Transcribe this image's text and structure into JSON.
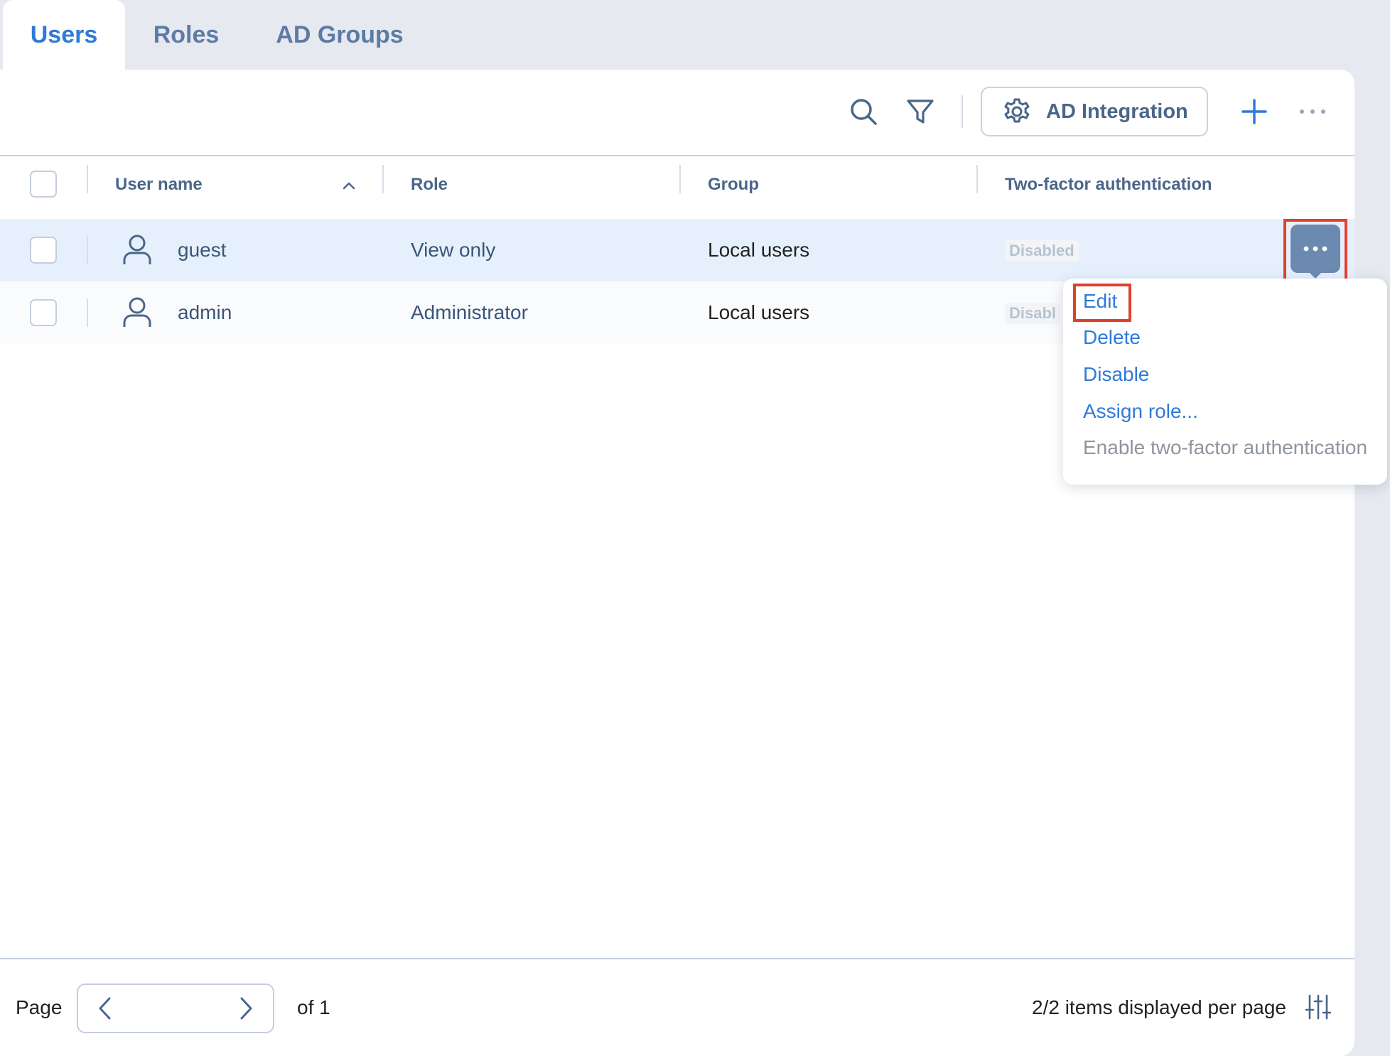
{
  "tabs": [
    {
      "label": "Users",
      "active": true
    },
    {
      "label": "Roles",
      "active": false
    },
    {
      "label": "AD Groups",
      "active": false
    }
  ],
  "toolbar": {
    "search_icon": "search-icon",
    "filter_icon": "filter-icon",
    "ad_integration_label": "AD Integration",
    "add_icon": "plus-icon",
    "more_icon": "more-horizontal-icon"
  },
  "table": {
    "columns": [
      "User name",
      "Role",
      "Group",
      "Two-factor authentication"
    ],
    "sort": {
      "column": "User name",
      "direction": "ascending"
    },
    "rows": [
      {
        "user": "guest",
        "role": "View only",
        "group": "Local users",
        "twofa": "Disabled",
        "selected": true
      },
      {
        "user": "admin",
        "role": "Administrator",
        "group": "Local users",
        "twofa": "Disabl",
        "selected": false
      }
    ]
  },
  "context_menu": {
    "items": [
      {
        "label": "Edit",
        "enabled": true,
        "highlighted": true
      },
      {
        "label": "Delete",
        "enabled": true
      },
      {
        "label": "Disable",
        "enabled": true
      },
      {
        "label": "Assign role...",
        "enabled": true
      },
      {
        "label": "Enable two-factor authentication",
        "enabled": false
      }
    ]
  },
  "footer": {
    "page_label": "Page",
    "of_label": "of 1",
    "items_label": "2/2 items displayed per page"
  },
  "colors": {
    "accent": "#2f7ad8",
    "header_text": "#4a6689",
    "row_selected_bg": "#e6f0fc",
    "highlight_box": "#e0412d",
    "row_menu_button": "#6c89b0"
  }
}
